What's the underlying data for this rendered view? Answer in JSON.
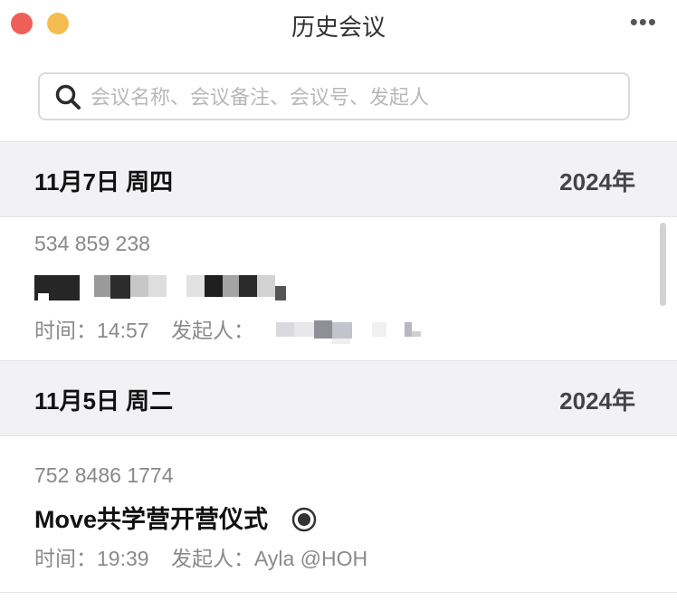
{
  "window": {
    "title": "历史会议",
    "more_glyph": "•••"
  },
  "search": {
    "placeholder": "会议名称、会议备注、会议号、发起人"
  },
  "groups": [
    {
      "date": "11月7日 周四",
      "year": "2024年",
      "meeting": {
        "number": "534 859 238",
        "title": "",
        "time_label": "时间：",
        "time": "14:57",
        "host_label": "发起人：",
        "host": ""
      }
    },
    {
      "date": "11月5日 周二",
      "year": "2024年",
      "meeting": {
        "number": "752 8486 1774",
        "title": "Move共学营开营仪式",
        "time_label": "时间：",
        "time": "19:39",
        "host_label": "发起人：",
        "host": "Ayla @HOH",
        "status_icon": "recording-indicator-icon"
      }
    }
  ],
  "colors": {
    "close": "#ee5f57",
    "minimize": "#f5bd4f",
    "header_bg": "#f2f2f4"
  }
}
